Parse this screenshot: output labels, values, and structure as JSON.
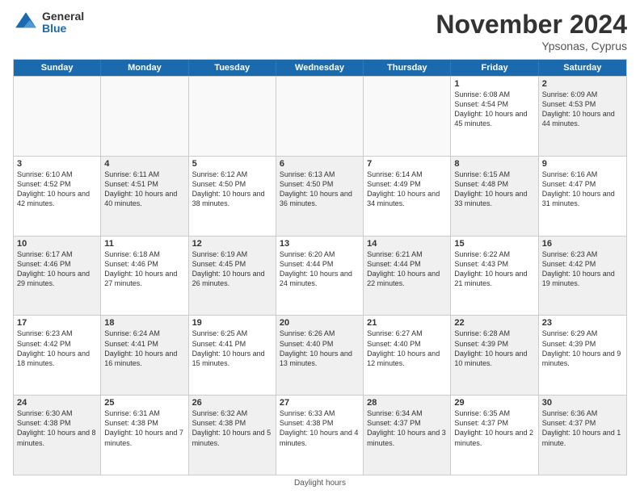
{
  "logo": {
    "general": "General",
    "blue": "Blue"
  },
  "title": {
    "month": "November 2024",
    "location": "Ypsonas, Cyprus"
  },
  "headers": [
    "Sunday",
    "Monday",
    "Tuesday",
    "Wednesday",
    "Thursday",
    "Friday",
    "Saturday"
  ],
  "weeks": [
    [
      {
        "day": "",
        "info": "",
        "empty": true
      },
      {
        "day": "",
        "info": "",
        "empty": true
      },
      {
        "day": "",
        "info": "",
        "empty": true
      },
      {
        "day": "",
        "info": "",
        "empty": true
      },
      {
        "day": "",
        "info": "",
        "empty": true
      },
      {
        "day": "1",
        "info": "Sunrise: 6:08 AM\nSunset: 4:54 PM\nDaylight: 10 hours and 45 minutes.",
        "empty": false
      },
      {
        "day": "2",
        "info": "Sunrise: 6:09 AM\nSunset: 4:53 PM\nDaylight: 10 hours and 44 minutes.",
        "empty": false,
        "shaded": true
      }
    ],
    [
      {
        "day": "3",
        "info": "Sunrise: 6:10 AM\nSunset: 4:52 PM\nDaylight: 10 hours and 42 minutes.",
        "empty": false
      },
      {
        "day": "4",
        "info": "Sunrise: 6:11 AM\nSunset: 4:51 PM\nDaylight: 10 hours and 40 minutes.",
        "empty": false,
        "shaded": true
      },
      {
        "day": "5",
        "info": "Sunrise: 6:12 AM\nSunset: 4:50 PM\nDaylight: 10 hours and 38 minutes.",
        "empty": false
      },
      {
        "day": "6",
        "info": "Sunrise: 6:13 AM\nSunset: 4:50 PM\nDaylight: 10 hours and 36 minutes.",
        "empty": false,
        "shaded": true
      },
      {
        "day": "7",
        "info": "Sunrise: 6:14 AM\nSunset: 4:49 PM\nDaylight: 10 hours and 34 minutes.",
        "empty": false
      },
      {
        "day": "8",
        "info": "Sunrise: 6:15 AM\nSunset: 4:48 PM\nDaylight: 10 hours and 33 minutes.",
        "empty": false,
        "shaded": true
      },
      {
        "day": "9",
        "info": "Sunrise: 6:16 AM\nSunset: 4:47 PM\nDaylight: 10 hours and 31 minutes.",
        "empty": false
      }
    ],
    [
      {
        "day": "10",
        "info": "Sunrise: 6:17 AM\nSunset: 4:46 PM\nDaylight: 10 hours and 29 minutes.",
        "empty": false,
        "shaded": true
      },
      {
        "day": "11",
        "info": "Sunrise: 6:18 AM\nSunset: 4:46 PM\nDaylight: 10 hours and 27 minutes.",
        "empty": false
      },
      {
        "day": "12",
        "info": "Sunrise: 6:19 AM\nSunset: 4:45 PM\nDaylight: 10 hours and 26 minutes.",
        "empty": false,
        "shaded": true
      },
      {
        "day": "13",
        "info": "Sunrise: 6:20 AM\nSunset: 4:44 PM\nDaylight: 10 hours and 24 minutes.",
        "empty": false
      },
      {
        "day": "14",
        "info": "Sunrise: 6:21 AM\nSunset: 4:44 PM\nDaylight: 10 hours and 22 minutes.",
        "empty": false,
        "shaded": true
      },
      {
        "day": "15",
        "info": "Sunrise: 6:22 AM\nSunset: 4:43 PM\nDaylight: 10 hours and 21 minutes.",
        "empty": false
      },
      {
        "day": "16",
        "info": "Sunrise: 6:23 AM\nSunset: 4:42 PM\nDaylight: 10 hours and 19 minutes.",
        "empty": false,
        "shaded": true
      }
    ],
    [
      {
        "day": "17",
        "info": "Sunrise: 6:23 AM\nSunset: 4:42 PM\nDaylight: 10 hours and 18 minutes.",
        "empty": false
      },
      {
        "day": "18",
        "info": "Sunrise: 6:24 AM\nSunset: 4:41 PM\nDaylight: 10 hours and 16 minutes.",
        "empty": false,
        "shaded": true
      },
      {
        "day": "19",
        "info": "Sunrise: 6:25 AM\nSunset: 4:41 PM\nDaylight: 10 hours and 15 minutes.",
        "empty": false
      },
      {
        "day": "20",
        "info": "Sunrise: 6:26 AM\nSunset: 4:40 PM\nDaylight: 10 hours and 13 minutes.",
        "empty": false,
        "shaded": true
      },
      {
        "day": "21",
        "info": "Sunrise: 6:27 AM\nSunset: 4:40 PM\nDaylight: 10 hours and 12 minutes.",
        "empty": false
      },
      {
        "day": "22",
        "info": "Sunrise: 6:28 AM\nSunset: 4:39 PM\nDaylight: 10 hours and 10 minutes.",
        "empty": false,
        "shaded": true
      },
      {
        "day": "23",
        "info": "Sunrise: 6:29 AM\nSunset: 4:39 PM\nDaylight: 10 hours and 9 minutes.",
        "empty": false
      }
    ],
    [
      {
        "day": "24",
        "info": "Sunrise: 6:30 AM\nSunset: 4:38 PM\nDaylight: 10 hours and 8 minutes.",
        "empty": false,
        "shaded": true
      },
      {
        "day": "25",
        "info": "Sunrise: 6:31 AM\nSunset: 4:38 PM\nDaylight: 10 hours and 7 minutes.",
        "empty": false
      },
      {
        "day": "26",
        "info": "Sunrise: 6:32 AM\nSunset: 4:38 PM\nDaylight: 10 hours and 5 minutes.",
        "empty": false,
        "shaded": true
      },
      {
        "day": "27",
        "info": "Sunrise: 6:33 AM\nSunset: 4:38 PM\nDaylight: 10 hours and 4 minutes.",
        "empty": false
      },
      {
        "day": "28",
        "info": "Sunrise: 6:34 AM\nSunset: 4:37 PM\nDaylight: 10 hours and 3 minutes.",
        "empty": false,
        "shaded": true
      },
      {
        "day": "29",
        "info": "Sunrise: 6:35 AM\nSunset: 4:37 PM\nDaylight: 10 hours and 2 minutes.",
        "empty": false
      },
      {
        "day": "30",
        "info": "Sunrise: 6:36 AM\nSunset: 4:37 PM\nDaylight: 10 hours and 1 minute.",
        "empty": false,
        "shaded": true
      }
    ]
  ],
  "footer": "Daylight hours"
}
